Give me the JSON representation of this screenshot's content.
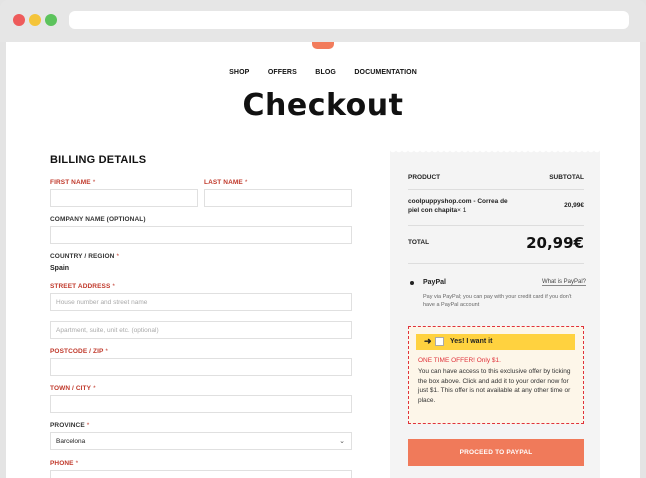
{
  "nav": {
    "items": [
      "SHOP",
      "OFFERS",
      "BLOG",
      "DOCUMENTATION"
    ]
  },
  "page_title": "Checkout",
  "billing": {
    "heading": "BILLING DETAILS",
    "first_name_label": "FIRST NAME",
    "last_name_label": "LAST NAME",
    "company_label": "COMPANY NAME (OPTIONAL)",
    "country_label": "COUNTRY / REGION",
    "country_value": "Spain",
    "street_label": "STREET ADDRESS",
    "street_placeholder": "House number and street name",
    "street2_placeholder": "Apartment, suite, unit etc. (optional)",
    "postcode_label": "POSTCODE / ZIP",
    "town_label": "TOWN / CITY",
    "province_label": "PROVINCE",
    "province_value": "Barcelona",
    "phone_label": "PHONE",
    "required_mark": "*"
  },
  "order": {
    "product_header": "PRODUCT",
    "subtotal_header": "SUBTOTAL",
    "product_name": "coolpuppyshop.com - Correa de piel con chapita",
    "product_qty": "× 1",
    "product_price": "20,99€",
    "total_label": "TOTAL",
    "total_value": "20,99€"
  },
  "payment": {
    "method_name": "PayPal",
    "what_link": "What is PayPal?",
    "description": "Pay via PayPal; you can pay with your credit card if you don't have a PayPal account"
  },
  "offer": {
    "arrow": "➜",
    "yes_label": "Yes! I want it",
    "one_time": "ONE TIME OFFER! Only $1.",
    "text": "You can have access to this exclusive offer by ticking the box above. Click and add it to your order now for just $1. This offer is not available at any other time or place."
  },
  "proceed_label": "PROCEED TO PAYPAL",
  "colors": {
    "accent": "#f07a5a",
    "required": "#c0392b",
    "offer_border": "#e0323a",
    "offer_bar": "#ffd23f"
  }
}
